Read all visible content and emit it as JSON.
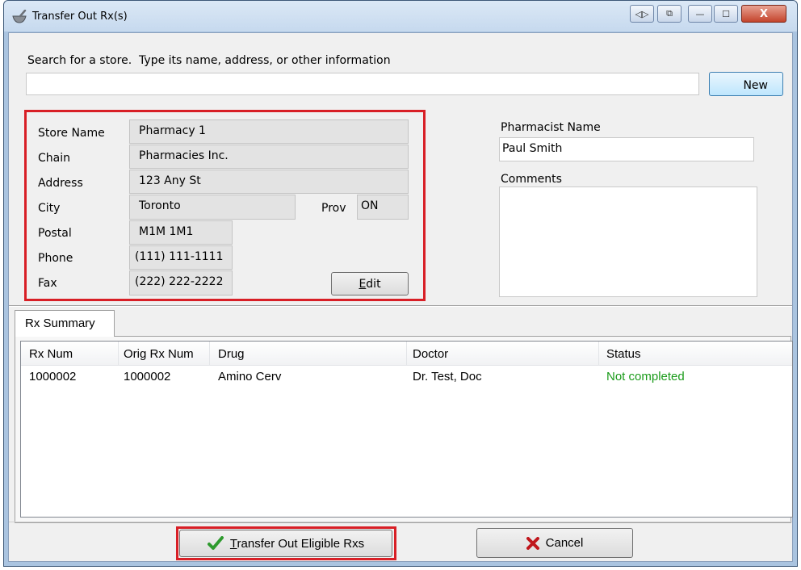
{
  "window": {
    "title": "Transfer Out Rx(s)",
    "controls": {
      "nav": "◁▷",
      "restore_extra": "⧉",
      "minimize": "—",
      "maximize": "☐",
      "close": "X"
    }
  },
  "search": {
    "label": "Search for a store.  Type its name, address, or other information",
    "value": "",
    "new_label": "New"
  },
  "store": {
    "labels": {
      "name": "Store Name",
      "chain": "Chain",
      "address": "Address",
      "city": "City",
      "prov": "Prov",
      "postal": "Postal",
      "phone": "Phone",
      "fax": "Fax"
    },
    "values": {
      "name": "Pharmacy 1",
      "chain": "Pharmacies Inc.",
      "address": "123 Any St",
      "city": "Toronto",
      "prov": "ON",
      "postal": "M1M 1M1",
      "phone": "(111) 111-1111",
      "fax": "(222) 222-2222"
    },
    "edit_label_rest": "dit",
    "edit_label_accel": "E"
  },
  "pharmacist": {
    "label": "Pharmacist Name",
    "value": "Paul Smith"
  },
  "comments": {
    "label": "Comments",
    "value": ""
  },
  "tabs": {
    "rx_summary": "Rx Summary"
  },
  "grid": {
    "columns": [
      "Rx Num",
      "Orig Rx Num",
      "Drug",
      "Doctor",
      "Status"
    ],
    "rows": [
      {
        "rx_num": "1000002",
        "orig_rx_num": "1000002",
        "drug": "Amino Cerv",
        "doctor": "Dr. Test, Doc",
        "status": "Not completed"
      }
    ]
  },
  "buttons": {
    "transfer_accel": "T",
    "transfer_rest": "ransfer Out Eligible Rxs",
    "cancel": "Cancel"
  },
  "colors": {
    "highlight_red": "#d81f26",
    "status_green": "#1a9b1a",
    "check_green": "#2e9a2e",
    "cancel_red": "#c0171d"
  }
}
